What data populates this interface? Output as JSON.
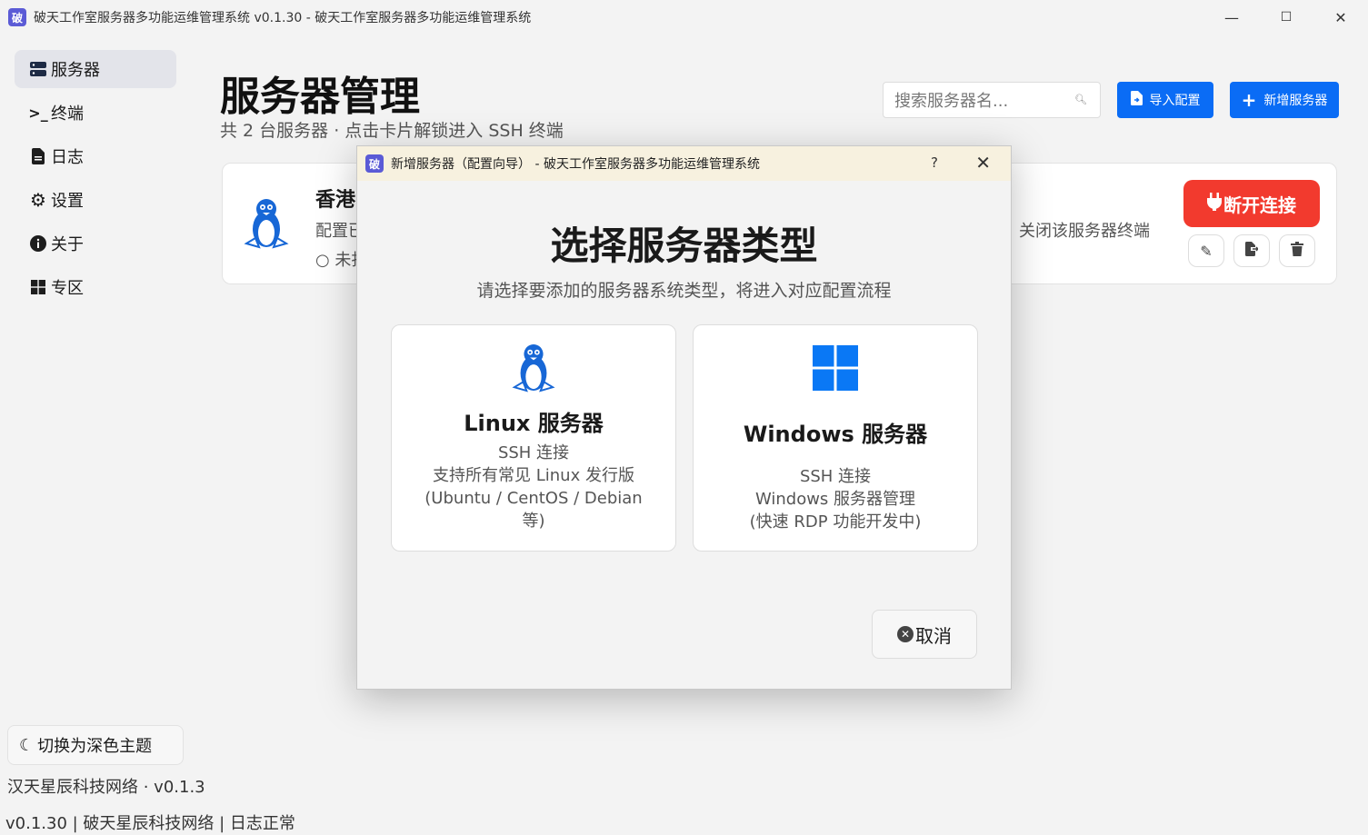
{
  "window": {
    "app_icon_char": "破",
    "title": "破天工作室服务器多功能运维管理系统 v0.1.30 - 破天工作室服务器多功能运维管理系统",
    "minimize": "—",
    "maximize": "☐",
    "close": "✕"
  },
  "sidebar": {
    "items": [
      {
        "label": "服务器",
        "icon": "server-icon"
      },
      {
        "label": "终端",
        "icon": "terminal-icon"
      },
      {
        "label": "日志",
        "icon": "file-icon"
      },
      {
        "label": "设置",
        "icon": "gear-icon"
      },
      {
        "label": "关于",
        "icon": "info-icon"
      },
      {
        "label": "专区",
        "icon": "windows-icon"
      }
    ],
    "theme_toggle": "切换为深色主题",
    "version_text": "汉天星辰科技网络 · v0.1.3"
  },
  "status_bar": "v0.1.30 | 破天星辰科技网络 | 日志正常",
  "main": {
    "title": "服务器管理",
    "subtitle": "共 2 台服务器 · 点击卡片解锁进入 SSH 终端",
    "search_placeholder": "搜索服务器名...",
    "import_label": "导入配置",
    "new_label": "新增服务器"
  },
  "server_card": {
    "title": "香港",
    "line1": "配置已",
    "line2": "○ 未打",
    "hint": "关闭该服务器终端",
    "disconnect_label": "断开连接"
  },
  "dialog": {
    "title": "新增服务器（配置向导） - 破天工作室服务器多功能运维管理系统",
    "help": "?",
    "close": "✕",
    "heading": "选择服务器类型",
    "subtitle": "请选择要添加的服务器系统类型，将进入对应配置流程",
    "linux": {
      "title": "Linux 服务器",
      "desc": [
        "SSH 连接",
        "支持所有常见 Linux 发行版",
        "(Ubuntu / CentOS / Debian",
        "等)"
      ]
    },
    "windows": {
      "title": "Windows 服务器",
      "desc": [
        "SSH 连接",
        "Windows 服务器管理",
        "(快速 RDP 功能开发中)"
      ]
    },
    "cancel_label": "取消"
  },
  "colors": {
    "accent": "#0a6cf5",
    "danger": "#f23a2e",
    "windows_blue": "#0a78f5"
  }
}
